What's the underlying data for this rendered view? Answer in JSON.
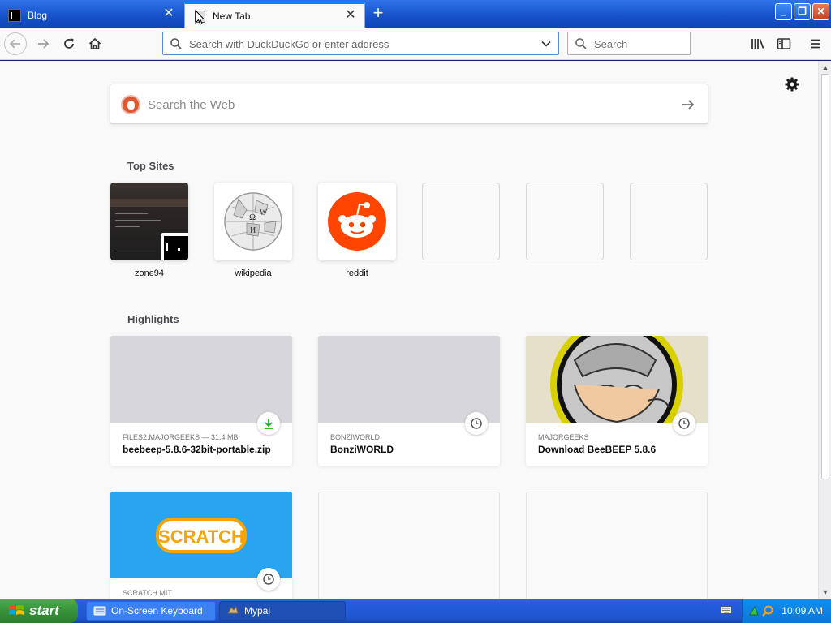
{
  "tabs": [
    {
      "label": "Blog",
      "active": false
    },
    {
      "label": "New Tab",
      "active": true
    }
  ],
  "toolbar": {
    "url_placeholder": "Search with DuckDuckGo or enter address",
    "search_placeholder": "Search"
  },
  "newtab": {
    "websearch_placeholder": "Search the Web",
    "top_sites_title": "Top Sites",
    "top_sites": [
      {
        "label": "zone94"
      },
      {
        "label": "wikipedia"
      },
      {
        "label": "reddit"
      }
    ],
    "highlights_title": "Highlights",
    "highlights": [
      {
        "source": "FILES2.MAJORGEEKS — 31.4 MB",
        "title": "beebeep-5.8.6-32bit-portable.zip",
        "badge": "download-icon"
      },
      {
        "source": "BONZIWORLD",
        "title": "BonziWORLD",
        "badge": "clock-icon"
      },
      {
        "source": "MAJORGEEKS",
        "title": "Download BeeBEEP 5.8.6",
        "badge": "clock-icon"
      },
      {
        "source": "SCRATCH.MIT",
        "title": "",
        "badge": "clock-icon"
      }
    ],
    "scratch_logo_text": "SCRATCH"
  },
  "taskbar": {
    "start_label": "start",
    "items": [
      {
        "label": "On-Screen Keyboard"
      },
      {
        "label": "Mypal"
      }
    ],
    "clock": "10:09 AM"
  },
  "colors": {
    "accent": "#0a84ff",
    "reddit": "#ff4500",
    "duckduckgo": "#de5833",
    "scratch_bg": "#29a4ef",
    "download_green": "#12bc00"
  }
}
